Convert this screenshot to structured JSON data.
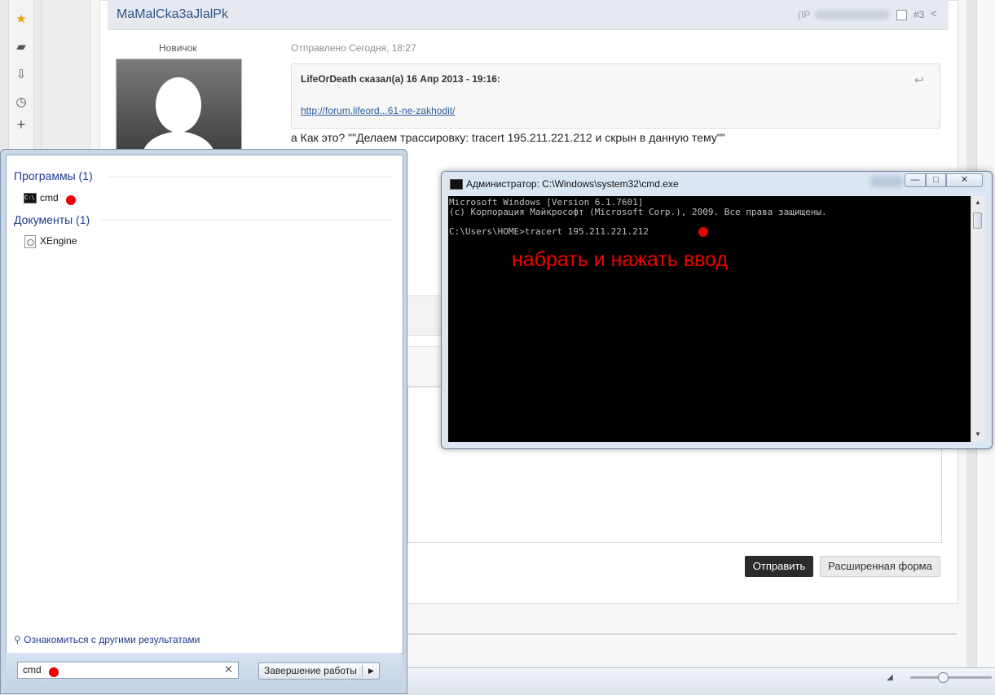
{
  "forum": {
    "post": {
      "author": "MaMalCka3aJlalPk",
      "ip_label": "(IP",
      "post_number": "#3",
      "rank": "Новичок",
      "sent": "Отправлено Сегодня, 18:27",
      "quote_author": "LifeOrDeath сказал(а) 16 Апр 2013 - 19:16:",
      "quote_link": "http://forum.lifeord...61-ne-zakhodit/",
      "body": "а Как это? \"\"Делаем трассировку:  tracert 195.211.221.212 и скрын в данную тему\"\""
    },
    "reply": {
      "send_label": "Отправить",
      "advanced_label": "Расширенная форма"
    }
  },
  "start_menu": {
    "groups": [
      {
        "title": "Программы (1)",
        "items": [
          {
            "label": "cmd",
            "icon": "cmd-icon"
          }
        ]
      },
      {
        "title": "Документы (1)",
        "items": [
          {
            "label": "XEngine",
            "icon": "document-icon"
          }
        ]
      }
    ],
    "more_results": "Ознакомиться с другими результатами",
    "search_value": "cmd",
    "shutdown_label": "Завершение работы"
  },
  "cmd_window": {
    "title": "Администратор: C:\\Windows\\system32\\cmd.exe",
    "lines": [
      "Microsoft Windows [Version 6.1.7601]",
      "(c) Корпорация Майкрософт (Microsoft Corp.), 2009. Все права защищены.",
      "",
      "C:\\Users\\HOME>tracert 195.211.221.212"
    ],
    "annotation": "набрать и нажать ввод",
    "controls": {
      "minimize": "—",
      "maximize": "□",
      "close": "✕"
    }
  },
  "colors": {
    "accent": "#2f5486",
    "annotation_red": "#ee0000",
    "console_bg": "#000000",
    "console_text": "#c0c0c0"
  }
}
